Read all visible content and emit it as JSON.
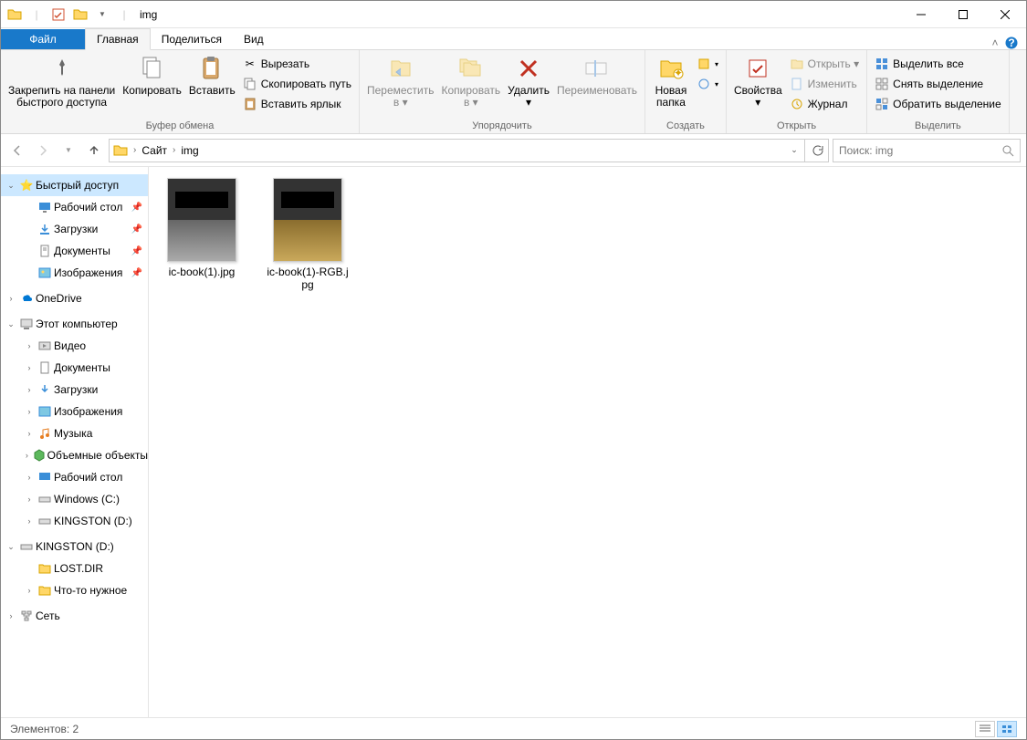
{
  "title": "img",
  "tabs": {
    "file": "Файл",
    "home": "Главная",
    "share": "Поделиться",
    "view": "Вид"
  },
  "ribbon": {
    "pin": "Закрепить на панели\nбыстрого доступа",
    "copy": "Копировать",
    "paste": "Вставить",
    "cut": "Вырезать",
    "copypath": "Скопировать путь",
    "pasteshortcut": "Вставить ярлык",
    "clipboard_label": "Буфер обмена",
    "moveto": "Переместить\nв ▾",
    "copyto": "Копировать\nв ▾",
    "delete": "Удалить\n▾",
    "rename": "Переименовать",
    "organize_label": "Упорядочить",
    "newfolder": "Новая\nпапка",
    "create_label": "Создать",
    "properties": "Свойства\n▾",
    "open": "Открыть ▾",
    "edit": "Изменить",
    "history": "Журнал",
    "open_label": "Открыть",
    "selectall": "Выделить все",
    "selectnone": "Снять выделение",
    "invertsel": "Обратить выделение",
    "select_label": "Выделить"
  },
  "breadcrumbs": [
    "Сайт",
    "img"
  ],
  "search_placeholder": "Поиск: img",
  "nav": {
    "quick": "Быстрый доступ",
    "desktop": "Рабочий стол",
    "downloads": "Загрузки",
    "documents": "Документы",
    "pictures": "Изображения",
    "onedrive": "OneDrive",
    "thispc": "Этот компьютер",
    "videos": "Видео",
    "documents2": "Документы",
    "downloads2": "Загрузки",
    "pictures2": "Изображения",
    "music": "Музыка",
    "objects3d": "Объемные объекты",
    "desktop2": "Рабочий стол",
    "windowsc": "Windows (C:)",
    "kingstond": "KINGSTON (D:)",
    "kingstond2": "KINGSTON (D:)",
    "lostdir": "LOST.DIR",
    "chtoto": "Что-то нужное",
    "network": "Сеть"
  },
  "files": [
    {
      "name": "ic-book(1).jpg"
    },
    {
      "name": "ic-book(1)-RGB.jpg"
    }
  ],
  "status": "Элементов: 2"
}
